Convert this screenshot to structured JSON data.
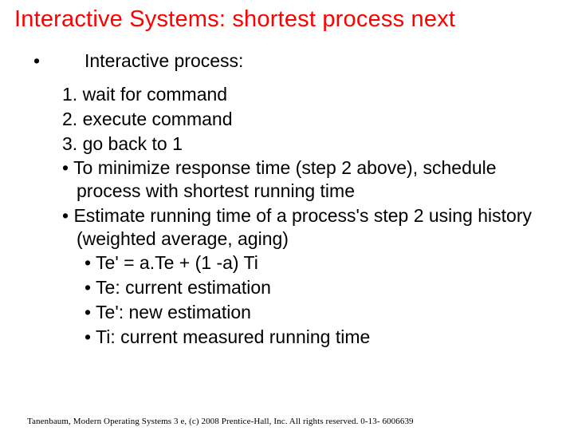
{
  "title": "Interactive Systems: shortest process next",
  "first_bullet_marker": "•",
  "first_bullet_text": "Interactive process:",
  "numbered": [
    "1. wait for command",
    "2. execute command",
    "3. go back to 1"
  ],
  "bullets": [
    "• To minimize response time (step 2 above), schedule process with shortest running time",
    "• Estimate running time of a process's step 2 using history (weighted average, aging)"
  ],
  "sub_bullets": [
    "• Te' = a.Te + (1 -a) Ti",
    "• Te: current estimation",
    "• Te': new estimation",
    "• Ti: current measured running time"
  ],
  "footer": "Tanenbaum, Modern Operating Systems 3 e, (c) 2008 Prentice-Hall, Inc. All rights reserved. 0-13- 6006639"
}
